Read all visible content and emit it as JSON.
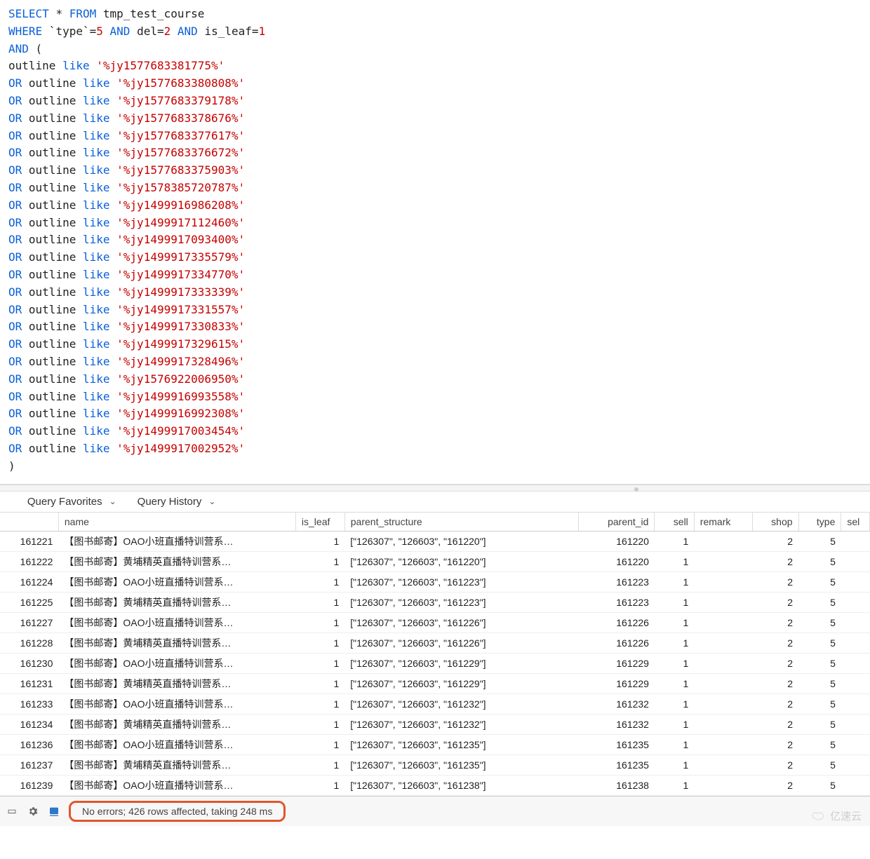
{
  "sql": {
    "line1": {
      "select": "SELECT",
      "star": "*",
      "from": "FROM",
      "table": "tmp_test_course"
    },
    "line2": {
      "where": "WHERE",
      "type_col": "`type`",
      "eq1": "=",
      "val1": "5",
      "and1": "AND",
      "del_col": "del",
      "eq2": "=",
      "val2": "2",
      "and2": "AND",
      "leaf_col": "is_leaf",
      "eq3": "=",
      "val3": "1"
    },
    "line3": {
      "and": "AND",
      "paren": "("
    },
    "first": {
      "col": "outline",
      "like": "like",
      "val": "'%jy1577683381775%'"
    },
    "rest_or": "OR",
    "rest_col": "outline",
    "rest_like": "like",
    "patterns": [
      "'%jy1577683380808%'",
      "'%jy1577683379178%'",
      "'%jy1577683378676%'",
      "'%jy1577683377617%'",
      "'%jy1577683376672%'",
      "'%jy1577683375903%'",
      "'%jy1578385720787%'",
      "'%jy1499916986208%'",
      "'%jy1499917112460%'",
      "'%jy1499917093400%'",
      "'%jy1499917335579%'",
      "'%jy1499917334770%'",
      "'%jy1499917333339%'",
      "'%jy1499917331557%'",
      "'%jy1499917330833%'",
      "'%jy1499917329615%'",
      "'%jy1499917328496%'",
      "'%jy1576922006950%'",
      "'%jy1499916993558%'",
      "'%jy1499916992308%'",
      "'%jy1499917003454%'",
      "'%jy1499917002952%'"
    ],
    "close": ")"
  },
  "toolbar": {
    "favorites": "Query Favorites",
    "history": "Query History"
  },
  "columns": {
    "id": "",
    "name": "name",
    "is_leaf": "is_leaf",
    "parent_structure": "parent_structure",
    "parent_id": "parent_id",
    "sell": "sell",
    "remark": "remark",
    "shop": "shop",
    "type": "type",
    "sel": "sel"
  },
  "rows": [
    {
      "id": "161221",
      "name": "【图书邮寄】OAO小班直播特训营系…",
      "is_leaf": "1",
      "parent_structure": "[\"126307\", \"126603\", \"161220\"]",
      "parent_id": "161220",
      "sell": "1",
      "remark": "",
      "shop": "2",
      "type": "5"
    },
    {
      "id": "161222",
      "name": "【图书邮寄】黄埔精英直播特训营系…",
      "is_leaf": "1",
      "parent_structure": "[\"126307\", \"126603\", \"161220\"]",
      "parent_id": "161220",
      "sell": "1",
      "remark": "",
      "shop": "2",
      "type": "5"
    },
    {
      "id": "161224",
      "name": "【图书邮寄】OAO小班直播特训营系…",
      "is_leaf": "1",
      "parent_structure": "[\"126307\", \"126603\", \"161223\"]",
      "parent_id": "161223",
      "sell": "1",
      "remark": "",
      "shop": "2",
      "type": "5"
    },
    {
      "id": "161225",
      "name": "【图书邮寄】黄埔精英直播特训营系…",
      "is_leaf": "1",
      "parent_structure": "[\"126307\", \"126603\", \"161223\"]",
      "parent_id": "161223",
      "sell": "1",
      "remark": "",
      "shop": "2",
      "type": "5"
    },
    {
      "id": "161227",
      "name": "【图书邮寄】OAO小班直播特训营系…",
      "is_leaf": "1",
      "parent_structure": "[\"126307\", \"126603\", \"161226\"]",
      "parent_id": "161226",
      "sell": "1",
      "remark": "",
      "shop": "2",
      "type": "5"
    },
    {
      "id": "161228",
      "name": "【图书邮寄】黄埔精英直播特训营系…",
      "is_leaf": "1",
      "parent_structure": "[\"126307\", \"126603\", \"161226\"]",
      "parent_id": "161226",
      "sell": "1",
      "remark": "",
      "shop": "2",
      "type": "5"
    },
    {
      "id": "161230",
      "name": "【图书邮寄】OAO小班直播特训营系…",
      "is_leaf": "1",
      "parent_structure": "[\"126307\", \"126603\", \"161229\"]",
      "parent_id": "161229",
      "sell": "1",
      "remark": "",
      "shop": "2",
      "type": "5"
    },
    {
      "id": "161231",
      "name": "【图书邮寄】黄埔精英直播特训营系…",
      "is_leaf": "1",
      "parent_structure": "[\"126307\", \"126603\", \"161229\"]",
      "parent_id": "161229",
      "sell": "1",
      "remark": "",
      "shop": "2",
      "type": "5"
    },
    {
      "id": "161233",
      "name": "【图书邮寄】OAO小班直播特训营系…",
      "is_leaf": "1",
      "parent_structure": "[\"126307\", \"126603\", \"161232\"]",
      "parent_id": "161232",
      "sell": "1",
      "remark": "",
      "shop": "2",
      "type": "5"
    },
    {
      "id": "161234",
      "name": "【图书邮寄】黄埔精英直播特训营系…",
      "is_leaf": "1",
      "parent_structure": "[\"126307\", \"126603\", \"161232\"]",
      "parent_id": "161232",
      "sell": "1",
      "remark": "",
      "shop": "2",
      "type": "5"
    },
    {
      "id": "161236",
      "name": "【图书邮寄】OAO小班直播特训营系…",
      "is_leaf": "1",
      "parent_structure": "[\"126307\", \"126603\", \"161235\"]",
      "parent_id": "161235",
      "sell": "1",
      "remark": "",
      "shop": "2",
      "type": "5"
    },
    {
      "id": "161237",
      "name": "【图书邮寄】黄埔精英直播特训营系…",
      "is_leaf": "1",
      "parent_structure": "[\"126307\", \"126603\", \"161235\"]",
      "parent_id": "161235",
      "sell": "1",
      "remark": "",
      "shop": "2",
      "type": "5"
    },
    {
      "id": "161239",
      "name": "【图书邮寄】OAO小班直播特训营系…",
      "is_leaf": "1",
      "parent_structure": "[\"126307\", \"126603\", \"161238\"]",
      "parent_id": "161238",
      "sell": "1",
      "remark": "",
      "shop": "2",
      "type": "5"
    }
  ],
  "status": {
    "text": "No errors; 426 rows affected, taking 248 ms"
  },
  "watermark": "亿速云"
}
